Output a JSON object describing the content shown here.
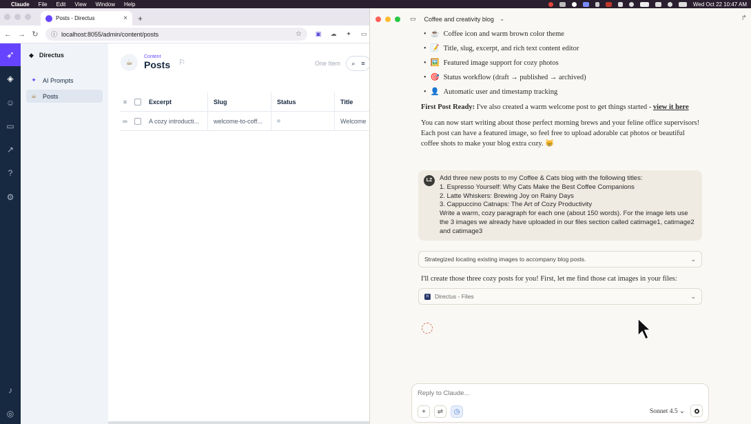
{
  "menubar": {
    "apple": "",
    "app_name": "Claude",
    "menus": [
      "File",
      "Edit",
      "View",
      "Window",
      "Help"
    ],
    "datetime": "Wed Oct 22  10:47 AM"
  },
  "browser": {
    "tab_title": "Posts - Directus",
    "url": "localhost:8055/admin/content/posts"
  },
  "directus": {
    "project_name": "Directus",
    "nav_items": [
      {
        "label": "AI Prompts",
        "icon": "sparkle-icon"
      },
      {
        "label": "Posts",
        "icon": "coffee-cup-icon"
      }
    ],
    "header": {
      "breadcrumb": "Content",
      "title": "Posts",
      "item_count": "One Item"
    },
    "table": {
      "columns": [
        "Excerpt",
        "Slug",
        "Status",
        "Title"
      ],
      "rows": [
        {
          "excerpt": "A cozy introducti...",
          "slug": "welcome-to-coff...",
          "status": "",
          "title": "Welcome"
        }
      ]
    }
  },
  "claude": {
    "chat_title": "Coffee and creativity blog",
    "bullets": [
      {
        "emoji": "☕",
        "text": "Coffee icon and warm brown color theme"
      },
      {
        "emoji": "📝",
        "text": "Title, slug, excerpt, and rich text content editor"
      },
      {
        "emoji": "🖼️",
        "text": "Featured image support for cozy photos"
      },
      {
        "emoji": "🎯",
        "text": "Status workflow (draft → published → archived)"
      },
      {
        "emoji": "👤",
        "text": "Automatic user and timestamp tracking"
      }
    ],
    "first_post": {
      "label": "First Post Ready:",
      "text": " I've also created a warm welcome post to get things started - ",
      "link": "view it here"
    },
    "closing_para": "You can now start writing about those perfect morning brews and your feline office supervisors! Each post can have a featured image, so feel free to upload adorable cat photos or beautiful coffee shots to make your blog extra cozy. 😸",
    "user_message": {
      "avatar": "LZ",
      "lines": [
        "Add three new posts to my Coffee & Cats blog with the following titles:",
        "1. Espresso Yourself: Why Cats Make the Best Coffee Companions",
        "2. Latte Whiskers: Brewing Joy on Rainy Days",
        "3. Cappuccino Catnaps: The Art of Cozy Productivity",
        "Write a warm, cozy paragraph for each one (about 150 words). For the image lets use the 3 images we already have uploaded in our files section called catimage1, catimage2 and catimage3"
      ]
    },
    "thinking_label": "Strategized locating existing images to accompany blog posts.",
    "assistant_reply": "I'll create those three cozy posts for you! First, let me find those cat images in your files:",
    "tool_call_label": "Directus - Files",
    "composer": {
      "placeholder": "Reply to Claude...",
      "model": "Sonnet 4.5"
    }
  }
}
